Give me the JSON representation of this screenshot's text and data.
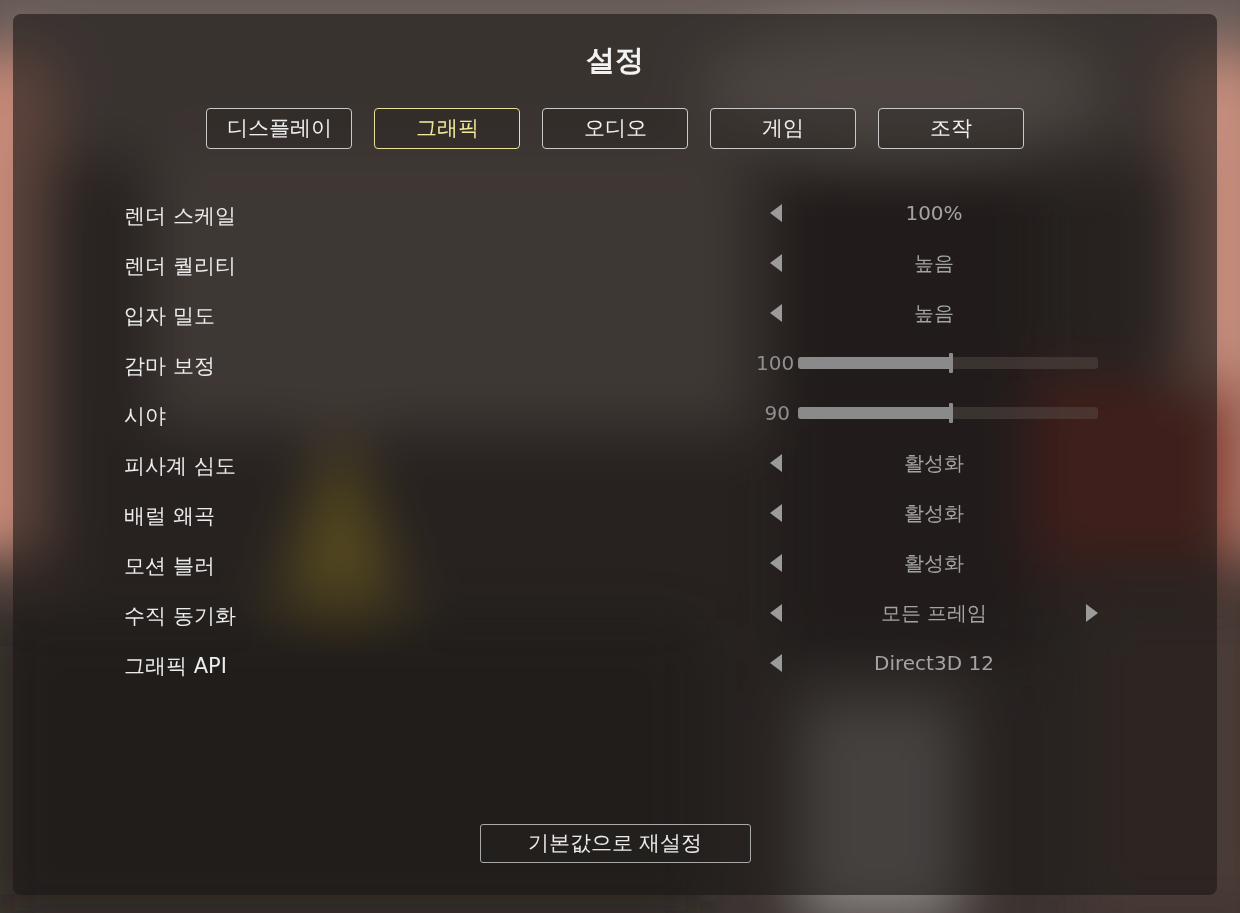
{
  "window": {
    "title": "설정"
  },
  "tabs": [
    {
      "label": "디스플레이",
      "selected": false
    },
    {
      "label": "그래픽",
      "selected": true
    },
    {
      "label": "오디오",
      "selected": false
    },
    {
      "label": "게임",
      "selected": false
    },
    {
      "label": "조작",
      "selected": false
    }
  ],
  "settings": [
    {
      "kind": "choice",
      "label": "렌더 스케일",
      "value": "100%",
      "has_prev": true,
      "has_next": false
    },
    {
      "kind": "choice",
      "label": "렌더 퀄리티",
      "value": "높음",
      "has_prev": true,
      "has_next": false
    },
    {
      "kind": "choice",
      "label": "입자 밀도",
      "value": "높음",
      "has_prev": true,
      "has_next": false
    },
    {
      "kind": "slider",
      "label": "감마 보정",
      "reading": "100",
      "level": 0.51
    },
    {
      "kind": "slider",
      "label": "시야",
      "reading": "90",
      "level": 0.51
    },
    {
      "kind": "choice",
      "label": "피사계 심도",
      "value": "활성화",
      "has_prev": true,
      "has_next": false
    },
    {
      "kind": "choice",
      "label": "배럴 왜곡",
      "value": "활성화",
      "has_prev": true,
      "has_next": false
    },
    {
      "kind": "choice",
      "label": "모션 블러",
      "value": "활성화",
      "has_prev": true,
      "has_next": false
    },
    {
      "kind": "choice",
      "label": "수직 동기화",
      "value": "모든 프레임",
      "has_prev": true,
      "has_next": true
    },
    {
      "kind": "choice",
      "label": "그래픽 API",
      "value": "Direct3D 12",
      "has_prev": true,
      "has_next": false
    }
  ],
  "reset_button": {
    "label": "기본값으로 재설정"
  }
}
